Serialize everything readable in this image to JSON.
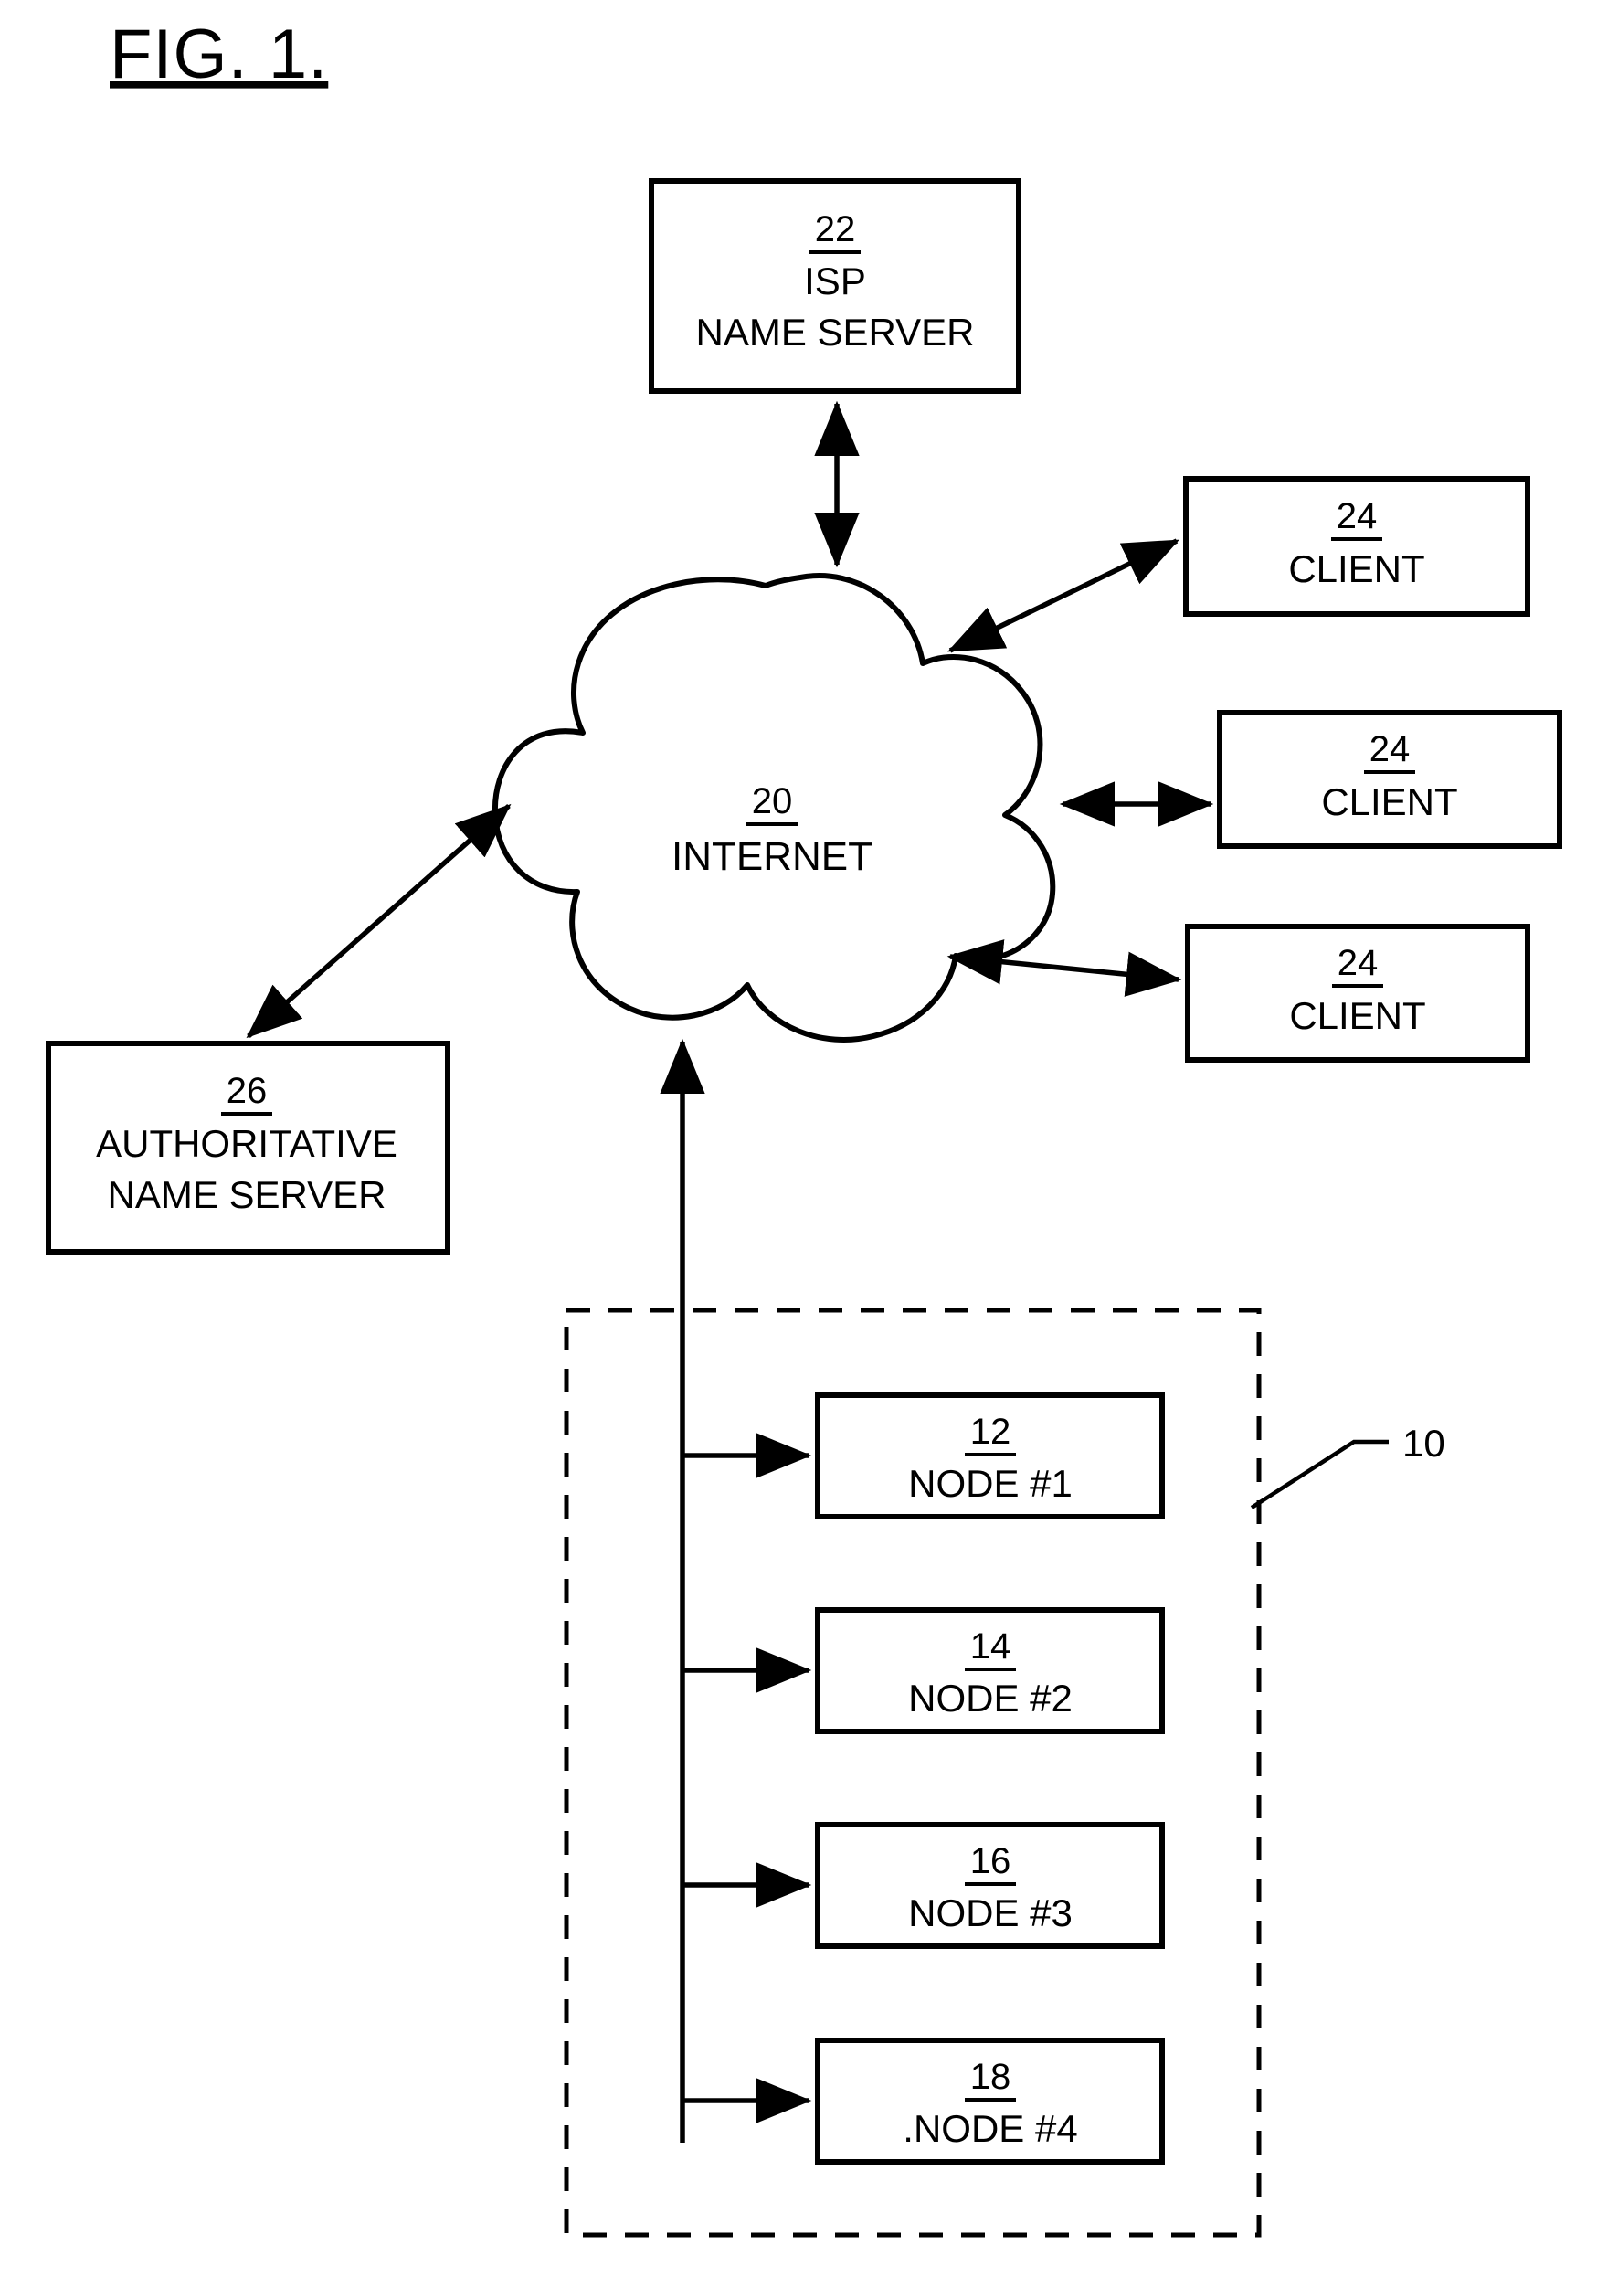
{
  "figure": {
    "title": "FIG. 1.",
    "callout": "10"
  },
  "blocks": {
    "isp_name_server": {
      "ref": "22",
      "line1": "ISP",
      "line2": "NAME SERVER"
    },
    "internet": {
      "ref": "20",
      "label": "INTERNET"
    },
    "authoritative_name_server": {
      "ref": "26",
      "line1": "AUTHORITATIVE",
      "line2": "NAME SERVER"
    },
    "clients": [
      {
        "ref": "24",
        "label": "CLIENT"
      },
      {
        "ref": "24",
        "label": "CLIENT"
      },
      {
        "ref": "24",
        "label": "CLIENT"
      }
    ],
    "nodes": [
      {
        "ref": "12",
        "label": "NODE #1"
      },
      {
        "ref": "14",
        "label": "NODE #2"
      },
      {
        "ref": "16",
        "label": "NODE #3"
      },
      {
        "ref": "18",
        "label": ".NODE #4"
      }
    ]
  },
  "colors": {
    "ink": "#000000",
    "paper": "#ffffff"
  }
}
